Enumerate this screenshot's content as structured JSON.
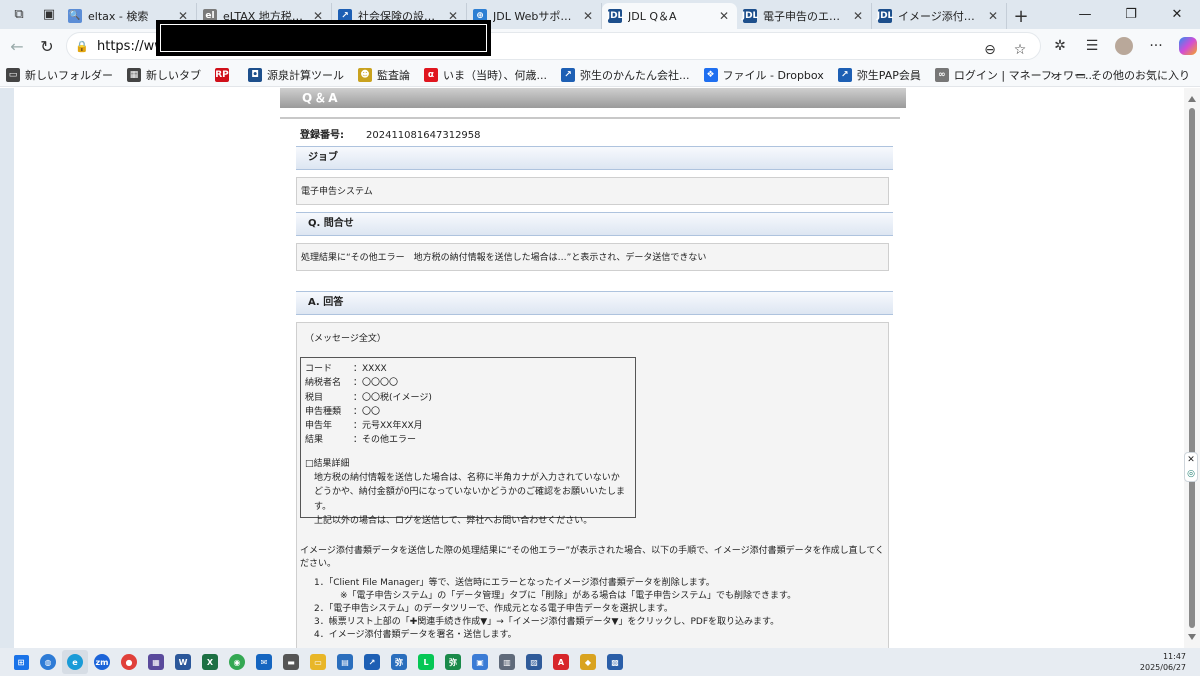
{
  "browser": {
    "tabs": [
      {
        "label": "eltax - 検索",
        "color": "#5b8dd6",
        "glyph": "🔍"
      },
      {
        "label": "eLTAX 地方税ポータ",
        "color": "#7a7a7a",
        "glyph": "el"
      },
      {
        "label": "社会保険の設定（",
        "color": "#1d5fb4",
        "glyph": "↗"
      },
      {
        "label": "JDL Webサポートセン",
        "color": "#2d7fd3",
        "glyph": "⊕"
      },
      {
        "label": "JDL Q＆A",
        "color": "#1d4f8c",
        "glyph": "JDL",
        "active": true
      },
      {
        "label": "電子申告のエラーメッ",
        "color": "#1d4f8c",
        "glyph": "JDL"
      },
      {
        "label": "イメージ添付書類（P",
        "color": "#1d4f8c",
        "glyph": "JDL"
      }
    ],
    "url_prefix": "https://www",
    "bookmarks": [
      {
        "label": "新しいフォルダー",
        "color": "#444",
        "glyph": "▭"
      },
      {
        "label": "新しいタブ",
        "color": "#444",
        "glyph": "▦"
      },
      {
        "label": "",
        "color": "#d0101a",
        "glyph": "RP"
      },
      {
        "label": "源泉計算ツール",
        "color": "#1d4f8c",
        "glyph": "◘"
      },
      {
        "label": "監査論",
        "color": "#c9a21f",
        "glyph": "☻"
      },
      {
        "label": "いま（当時）、何歳...",
        "color": "#e0161f",
        "glyph": "α"
      },
      {
        "label": "弥生のかんたん会社...",
        "color": "#1d5fb4",
        "glyph": "↗"
      },
      {
        "label": "ファイル - Dropbox",
        "color": "#1f6ff0",
        "glyph": "❖"
      },
      {
        "label": "弥生PAP会員",
        "color": "#1d5fb4",
        "glyph": "↗"
      },
      {
        "label": "ログイン | マネーフォワー...",
        "color": "#777",
        "glyph": "∞"
      }
    ],
    "other_favorites": "その他のお気に入り"
  },
  "page": {
    "header": "Q＆A",
    "reg_label": "登録番号:",
    "reg_value": "202411081647312958",
    "sect_job": "ジョブ",
    "job_value": "電子申告システム",
    "sect_q": "Q. 問合せ",
    "question": "処理結果に“その他エラー　地方税の納付情報を送信した場合は…”と表示され、データ送信できない",
    "sect_a": "A. 回答",
    "msg_title": "（メッセージ全文）",
    "msg_rows": [
      {
        "k": "コード",
        "v": "：XXXX"
      },
      {
        "k": "納税者名",
        "v": "：〇〇〇〇"
      },
      {
        "k": "税目",
        "v": "：〇〇税(イメージ)"
      },
      {
        "k": "申告種類",
        "v": "：〇〇"
      },
      {
        "k": "申告年",
        "v": "：元号XX年XX月"
      },
      {
        "k": "結果",
        "v": "：その他エラー"
      }
    ],
    "detail_title": "□結果詳細",
    "detail_lines": [
      "地方税の納付情報を送信した場合は、名称に半角カナが入力されていないか",
      "どうかや、納付金額が0円になっていないかどうかのご確認をお願いいたします。",
      "上記以外の場合は、ログを送信して、弊社へお問い合わせください。"
    ],
    "answer_intro": "イメージ添付書類データを送信した際の処理結果に“その他エラー”が表示された場合、以下の手順で、イメージ添付書類データを作成し直してください。",
    "steps": [
      "1．「Client File Manager」等で、送信時にエラーとなったイメージ添付書類データを削除します。",
      "　　※「電子申告システム」の「データ管理」タブに「削除」がある場合は「電子申告システム」でも削除できます。",
      "2．「電子申告システム」のデータツリーで、作成元となる電子申告データを選択します。",
      "3．帳票リスト上部の「✚関連手続き作成▼」→「イメージ添付書類データ▼」をクリックし、PDFを取り込みます。",
      "4．イメージ添付書類データを署名・送信します。"
    ]
  },
  "taskbar": {
    "time": "11:47",
    "date": "2025/06/27"
  }
}
